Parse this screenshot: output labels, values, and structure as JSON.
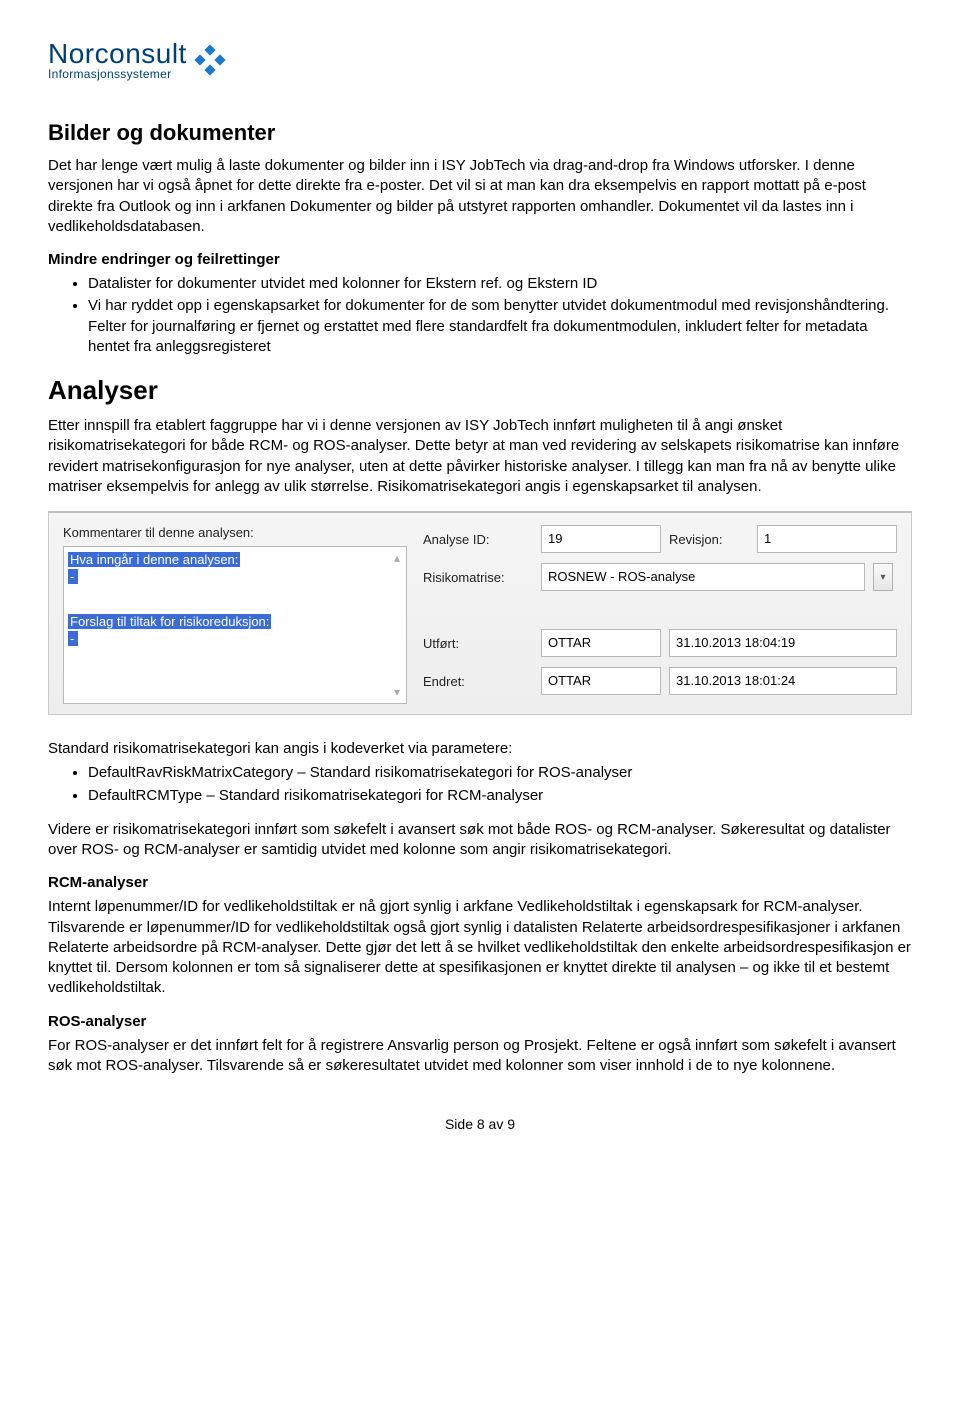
{
  "logo": {
    "top": "Norconsult",
    "sub": "Informasjonssystemer"
  },
  "section1": {
    "title": "Bilder og dokumenter",
    "para": "Det har lenge vært mulig å laste dokumenter og bilder inn i ISY JobTech via drag-and-drop fra Windows utforsker. I denne versjonen har vi også åpnet for dette direkte fra e-poster. Det vil si at man kan dra eksempelvis en rapport mottatt på e-post direkte fra Outlook og inn i arkfanen Dokumenter og bilder på utstyret rapporten omhandler. Dokumentet vil da lastes inn i vedlikeholdsdatabasen.",
    "subhead": "Mindre endringer og feilrettinger",
    "bullets": [
      "Datalister for dokumenter utvidet med kolonner for Ekstern ref. og Ekstern ID",
      "Vi har ryddet opp i egenskapsarket for dokumenter for de som benytter utvidet dokumentmodul med revisjonshåndtering. Felter for journalføring er fjernet og erstattet med flere standardfelt fra dokumentmodulen, inkludert felter for metadata hentet fra anleggsregisteret"
    ]
  },
  "section2": {
    "title": "Analyser",
    "para": "Etter innspill fra etablert faggruppe har vi i denne versjonen av ISY JobTech innført muligheten til å angi ønsket risikomatrisekategori for både RCM- og ROS-analyser. Dette betyr at man ved revidering av selskapets risikomatrise kan innføre revidert matrisekonfigurasjon for nye analyser, uten at dette påvirker historiske analyser. I tillegg kan man fra nå av benytte ulike matriser eksempelvis for anlegg av ulik størrelse. Risikomatrisekategori angis i egenskapsarket til analysen."
  },
  "shot": {
    "comment_label": "Kommentarer til denne analysen:",
    "comment_h1": "Hva inngår i denne analysen:",
    "comment_dash": "-",
    "comment_h2": "Forslag til tiltak for risikoreduksjon:",
    "analyse_id_label": "Analyse ID:",
    "analyse_id_value": "19",
    "revisjon_label": "Revisjon:",
    "revisjon_value": "1",
    "risikomatrise_label": "Risikomatrise:",
    "risikomatrise_value": "ROSNEW - ROS-analyse",
    "utfort_label": "Utført:",
    "utfort_user": "OTTAR",
    "utfort_ts": "31.10.2013 18:04:19",
    "endret_label": "Endret:",
    "endret_user": "OTTAR",
    "endret_ts": "31.10.2013 18:01:24"
  },
  "section3": {
    "para_intro": "Standard risikomatrisekategori kan angis i kodeverket via parametere:",
    "bullets": [
      "DefaultRavRiskMatrixCategory – Standard risikomatrisekategori for ROS-analyser",
      "DefaultRCMType – Standard risikomatrisekategori for RCM-analyser"
    ],
    "para_after": "Videre er risikomatrisekategori innført som søkefelt i avansert søk mot både ROS- og RCM-analyser. Søkeresultat og datalister over ROS- og RCM-analyser er samtidig utvidet med kolonne som angir risikomatrisekategori."
  },
  "section_rcm": {
    "title": "RCM-analyser",
    "para": "Internt løpenummer/ID for vedlikeholdstiltak er nå gjort synlig i arkfane Vedlikeholdstiltak i egenskapsark for RCM-analyser. Tilsvarende er løpenummer/ID for vedlikeholdstiltak også gjort synlig i datalisten Relaterte arbeidsordrespesifikasjoner i arkfanen Relaterte arbeidsordre på RCM-analyser. Dette gjør det lett å se hvilket vedlikeholdstiltak den enkelte arbeidsordrespesifikasjon er knyttet til. Dersom kolonnen er tom så signaliserer dette at spesifikasjonen er knyttet direkte til analysen – og ikke til et bestemt vedlikeholdstiltak."
  },
  "section_ros": {
    "title": "ROS-analyser",
    "para": "For ROS-analyser er det innført felt for å registrere Ansvarlig person og Prosjekt. Feltene er også innført som søkefelt i avansert søk mot ROS-analyser. Tilsvarende så er søkeresultatet utvidet med kolonner som viser innhold i de to nye kolonnene."
  },
  "footer": "Side 8 av 9"
}
